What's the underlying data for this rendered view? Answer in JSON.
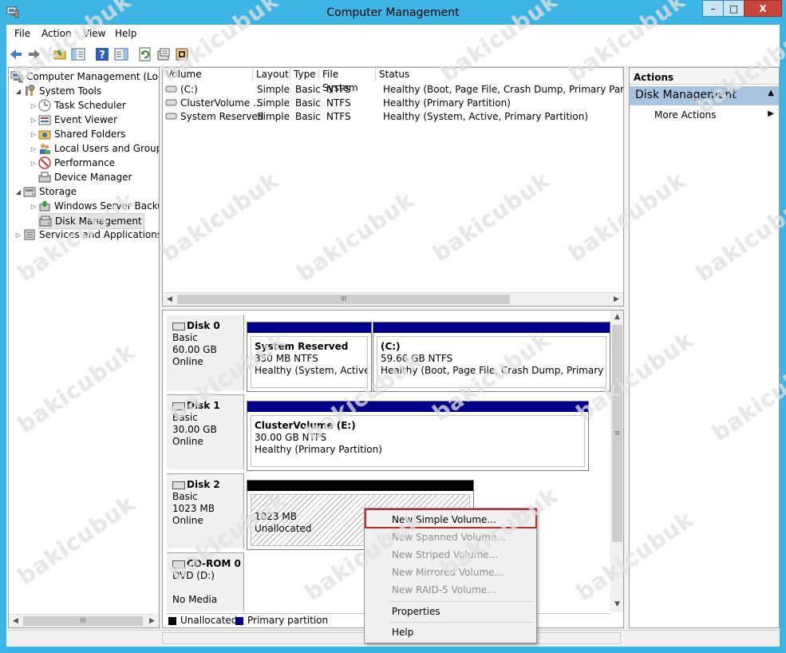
{
  "window": {
    "title": "Computer Management",
    "minimize": "–",
    "maximize": "□",
    "close": "X"
  },
  "menu": [
    "File",
    "Action",
    "View",
    "Help"
  ],
  "tree": {
    "root": "Computer Management (Local",
    "system_tools": "System Tools",
    "task_scheduler": "Task Scheduler",
    "event_viewer": "Event Viewer",
    "shared_folders": "Shared Folders",
    "local_users": "Local Users and Groups",
    "performance": "Performance",
    "device_manager": "Device Manager",
    "storage": "Storage",
    "wsb": "Windows Server Backup",
    "disk_mgmt": "Disk Management",
    "services": "Services and Applications"
  },
  "volume_list": {
    "headers": [
      "Volume",
      "Layout",
      "Type",
      "File System",
      "Status"
    ],
    "rows": [
      [
        "(C:)",
        "Simple",
        "Basic",
        "NTFS",
        "Healthy (Boot, Page File, Crash Dump, Primary Partition)"
      ],
      [
        "ClusterVolume ...",
        "Simple",
        "Basic",
        "NTFS",
        "Healthy (Primary Partition)"
      ],
      [
        "System Reserved",
        "Simple",
        "Basic",
        "NTFS",
        "Healthy (System, Active, Primary Partition)"
      ]
    ]
  },
  "disks": {
    "disk0": {
      "name": "Disk 0",
      "type": "Basic",
      "size": "60.00 GB",
      "status": "Online",
      "p1": {
        "name": "System Reserved",
        "size": "350 MB NTFS",
        "status": "Healthy (System, Active, Pr"
      },
      "p2": {
        "name": "(C:)",
        "size": "59.66 GB NTFS",
        "status": "Healthy (Boot, Page File, Crash Dump, Primary Partiti"
      }
    },
    "disk1": {
      "name": "Disk 1",
      "type": "Basic",
      "size": "30.00 GB",
      "status": "Online",
      "p1": {
        "name": "ClusterVolume  (E:)",
        "size": "30.00 GB NTFS",
        "status": "Healthy (Primary Partition)"
      }
    },
    "disk2": {
      "name": "Disk 2",
      "type": "Basic",
      "size": "1023 MB",
      "status": "Online",
      "p1": {
        "size": "1023 MB",
        "status": "Unallocated"
      }
    },
    "cdrom": {
      "name": "CD-ROM 0",
      "type": "DVD (D:)",
      "status": "No Media"
    }
  },
  "legend": {
    "unallocated": "Unallocated",
    "primary": "Primary partition"
  },
  "actions": {
    "header": "Actions",
    "section": "Disk Management",
    "more": "More Actions"
  },
  "context_menu": {
    "new_simple": "New Simple Volume...",
    "new_spanned": "New Spanned Volume...",
    "new_striped": "New Striped Volume...",
    "new_mirrored": "New Mirrored Volume...",
    "new_raid5": "New RAID-5 Volume...",
    "properties": "Properties",
    "help": "Help"
  },
  "watermark": "bakicubuk",
  "colors": {
    "primary": "#00008b",
    "unallocated": "#000000",
    "highlight": "#c0282a"
  }
}
